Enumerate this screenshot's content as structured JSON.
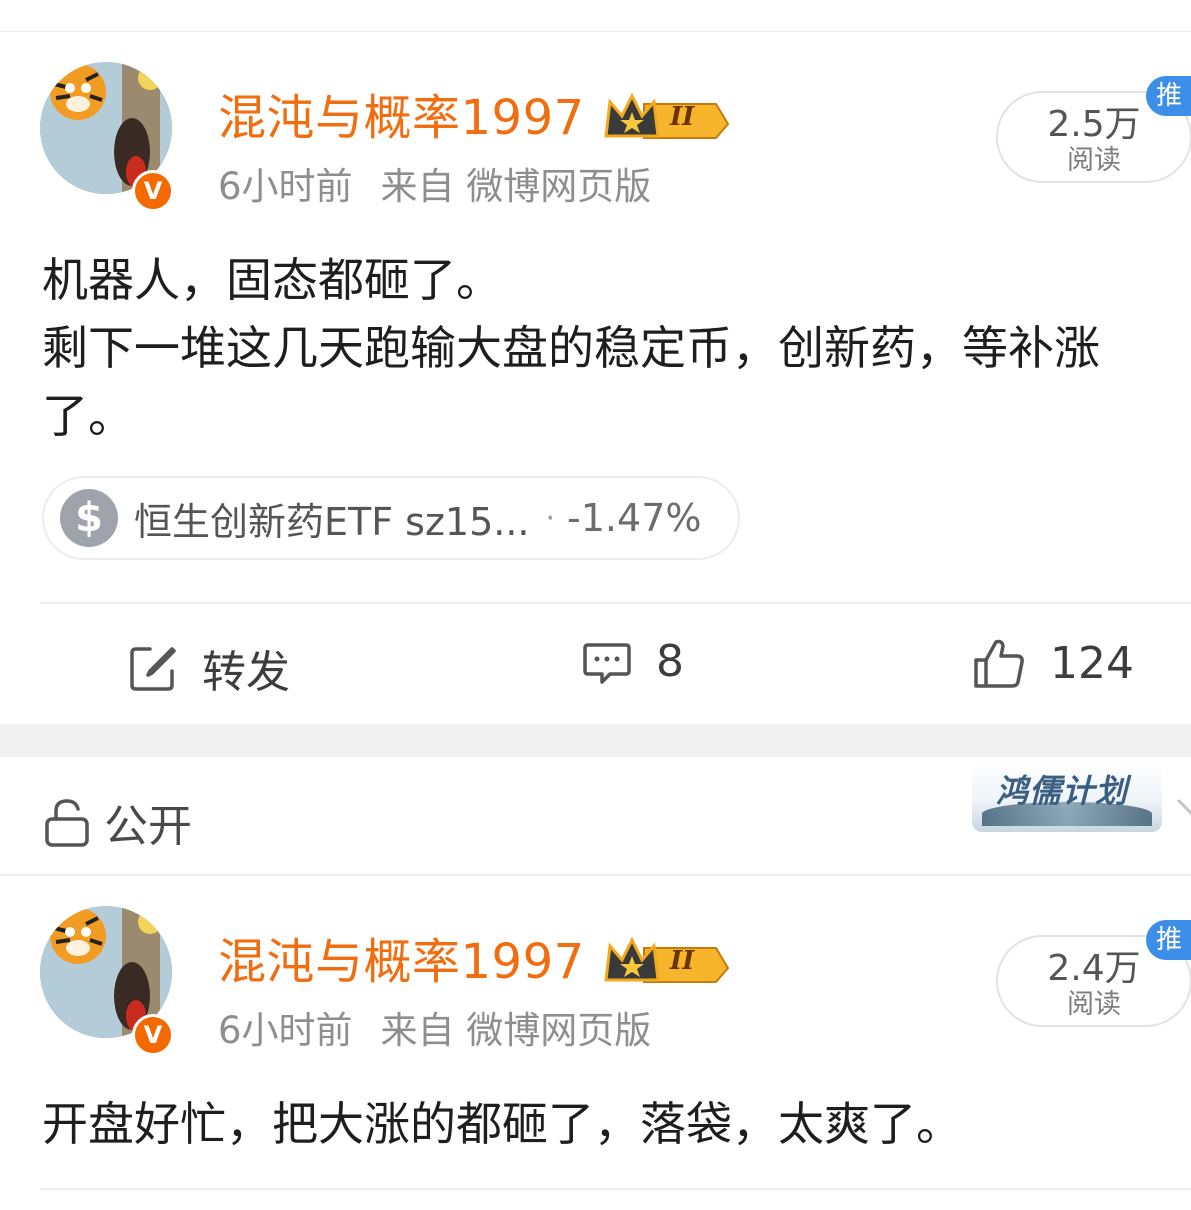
{
  "post1": {
    "username": "混沌与概率1997",
    "crown_level": "II",
    "time": "6小时前",
    "source": "来自 微博网页版",
    "reads": "2.5万",
    "reads_label": "阅读",
    "recommend_badge": "推广",
    "content_lines": [
      "机器人，固态都砸了。",
      "剩下一堆这几天跑输大盘的稳定币，创新药，等补涨",
      "了。"
    ],
    "stock_card": {
      "name": "恒生创新药ETF sz15...",
      "separator": "·",
      "change": "-1.47%"
    },
    "actions": {
      "repost_label": "转发",
      "comment_count": "8",
      "like_count": "124"
    }
  },
  "privacy": {
    "label": "公开",
    "plan_badge": "鸿儒计划"
  },
  "post2": {
    "username": "混沌与概率1997",
    "crown_level": "II",
    "time": "6小时前",
    "source": "来自 微博网页版",
    "reads": "2.4万",
    "reads_label": "阅读",
    "recommend_badge": "推广",
    "content": "开盘好忙，把大涨的都砸了，落袋，太爽了。"
  },
  "colors": {
    "username": "#f26d0f",
    "verified_badge": "#f46a00",
    "recommend_badge": "#3c8ee8",
    "crown": "#f2a91c"
  },
  "icons": {
    "repost": "edit-square-icon",
    "comment": "comment-bubble-icon",
    "like": "thumbs-up-icon",
    "privacy": "unlock-icon",
    "stock": "dollar-icon",
    "verified": "verified-v-icon",
    "crown": "crown-icon"
  }
}
